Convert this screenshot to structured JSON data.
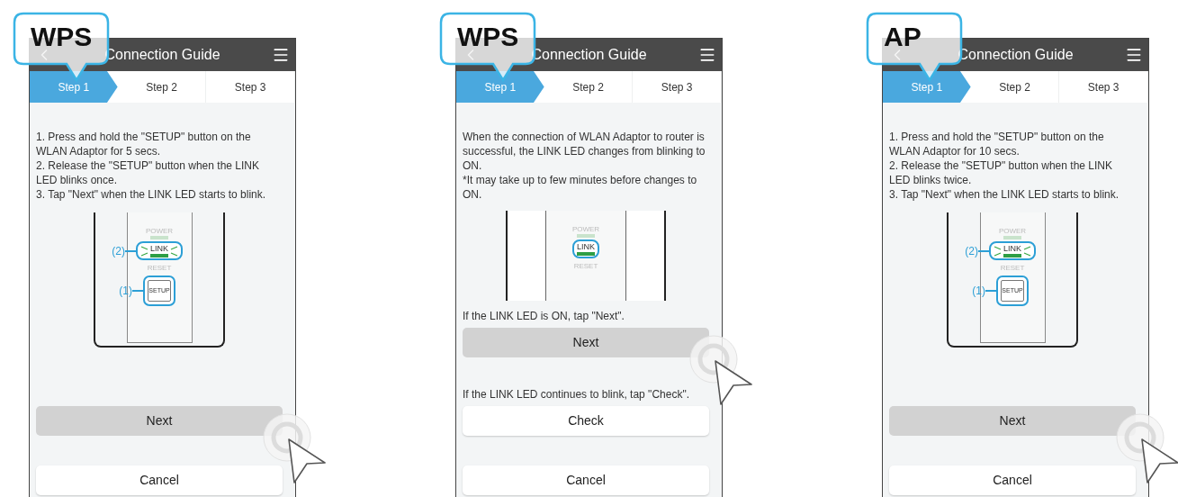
{
  "panels": [
    {
      "badge": "WPS",
      "title": "Connection Guide",
      "steps": [
        {
          "label": "Step 1",
          "selected": true
        },
        {
          "label": "Step 2",
          "selected": false
        },
        {
          "label": "Step 3",
          "selected": false
        }
      ],
      "content": [
        {
          "kind": "text",
          "paragraphs": [
            "1. Press and hold the \"SETUP\" button on the WLAN Adaptor for 5 secs.",
            "2. Release the \"SETUP\" button when the LINK LED blinks once.",
            "3. Tap \"Next\" when the LINK LED starts to blink."
          ]
        },
        {
          "kind": "diagram",
          "power": "POWER",
          "link": "LINK",
          "reset": "RESET",
          "link_blinking": true,
          "link_callout": "(2)",
          "setup": "SETUP",
          "setup_callout": "(1)"
        }
      ],
      "actions": [
        {
          "kind": "button",
          "label": "Next",
          "pressed": true
        },
        {
          "kind": "button",
          "label": "Cancel",
          "pressed": false
        }
      ]
    },
    {
      "badge": "WPS",
      "title": "Connection Guide",
      "steps": [
        {
          "label": "Step 1",
          "selected": true
        },
        {
          "label": "Step 2",
          "selected": false
        },
        {
          "label": "Step 3",
          "selected": false
        }
      ],
      "content": [
        {
          "kind": "text",
          "paragraphs": [
            "When the connection of WLAN Adaptor to router is successful, the LINK LED changes from blinking to ON.",
            "*It may take up to few minutes before changes to ON."
          ]
        },
        {
          "kind": "diagram",
          "power": "POWER",
          "link": "LINK",
          "reset": "RESET",
          "link_blinking": false
        }
      ],
      "actions": [
        {
          "kind": "note",
          "text": "If the LINK LED is ON, tap \"Next\"."
        },
        {
          "kind": "button",
          "label": "Next",
          "pressed": true
        },
        {
          "kind": "note",
          "text": "If the LINK LED continues to blink,  tap \"Check\"."
        },
        {
          "kind": "button",
          "label": "Check",
          "pressed": false
        },
        {
          "kind": "button",
          "label": "Cancel",
          "pressed": false
        }
      ]
    },
    {
      "badge": "AP",
      "title": "Connection Guide",
      "steps": [
        {
          "label": "Step 1",
          "selected": true
        },
        {
          "label": "Step 2",
          "selected": false
        },
        {
          "label": "Step 3",
          "selected": false
        }
      ],
      "content": [
        {
          "kind": "text",
          "paragraphs": [
            "1. Press and hold the \"SETUP\" button on the WLAN Adaptor for 10 secs.",
            "2. Release the \"SETUP\" button when the LINK LED blinks twice.",
            "3. Tap \"Next\" when the LINK LED starts to blink."
          ]
        },
        {
          "kind": "diagram",
          "power": "POWER",
          "link": "LINK",
          "reset": "RESET",
          "link_blinking": true,
          "link_callout": "(2)",
          "setup": "SETUP",
          "setup_callout": "(1)"
        }
      ],
      "actions": [
        {
          "kind": "button",
          "label": "Next",
          "pressed": true
        },
        {
          "kind": "button",
          "label": "Cancel",
          "pressed": false
        }
      ]
    }
  ]
}
